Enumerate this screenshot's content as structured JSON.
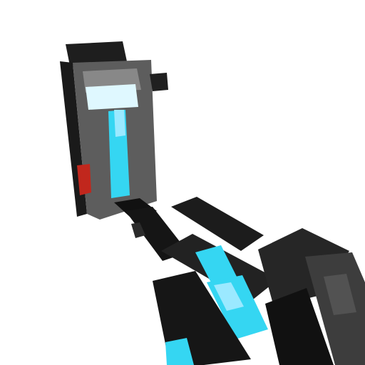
{
  "scene": {
    "background": "#ffffff",
    "subject": "blocky-weapon-model",
    "palette": {
      "dark": "#151515",
      "dark_mid": "#2a2a2a",
      "mid": "#4a4a4a",
      "light": "#8a8a8a",
      "glow": "#35d6f2",
      "glow_light": "#9be9ff",
      "glow_white": "#e6fbff",
      "red_accent": "#c1271d"
    }
  }
}
